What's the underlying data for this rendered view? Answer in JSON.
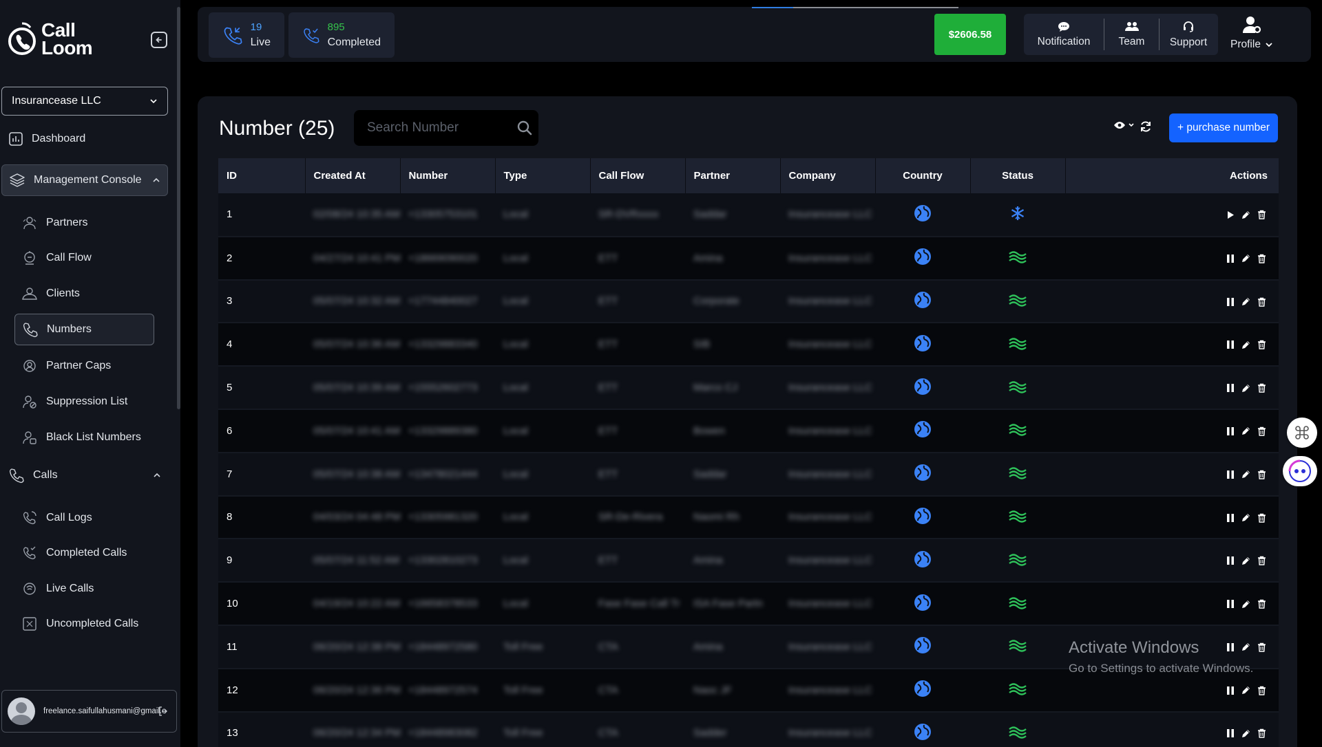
{
  "brand": {
    "name_line1": "Call",
    "name_line2": "Loom"
  },
  "company_selector": {
    "value": "Insurancease LLC"
  },
  "sidebar": {
    "dashboard": "Dashboard",
    "management_console": "Management Console",
    "management_items": [
      "Partners",
      "Call Flow",
      "Clients",
      "Numbers",
      "Partner Caps",
      "Suppression List",
      "Black List Numbers"
    ],
    "calls_group": "Calls",
    "calls_items": [
      "Call Logs",
      "Completed Calls",
      "Live Calls",
      "Uncompleted Calls"
    ],
    "user_email": "freelance.saifullahusmani@gmail.com"
  },
  "topbar": {
    "live": {
      "count": "19",
      "label": "Live"
    },
    "completed": {
      "count": "895",
      "label": "Completed"
    },
    "balance": "$2606.58",
    "notification": "Notification",
    "team": "Team",
    "support": "Support",
    "profile": "Profile"
  },
  "page": {
    "title": "Number (25)",
    "search_placeholder": "Search Number",
    "purchase_label": "+ purchase number"
  },
  "table": {
    "columns": [
      "ID",
      "Created At",
      "Number",
      "Type",
      "Call Flow",
      "Partner",
      "Company",
      "Country",
      "Status",
      "Actions"
    ],
    "rows": [
      {
        "id": "1",
        "created": "02/08/24 10:35 AM",
        "number": "+13305753101",
        "type": "Local",
        "flow": "SR-DVRxxxx",
        "partner": "Saddar",
        "company": "Insurancease LLC",
        "status": "paused"
      },
      {
        "id": "2",
        "created": "04/27/24 10:41 PM",
        "number": "+18669090020",
        "type": "Local",
        "flow": "ETT",
        "partner": "Amina",
        "company": "Insurancease LLC",
        "status": "active"
      },
      {
        "id": "3",
        "created": "05/07/24 10:32 AM",
        "number": "+17744840027",
        "type": "Local",
        "flow": "ETT",
        "partner": "Corporate",
        "company": "Insurancease LLC",
        "status": "active"
      },
      {
        "id": "4",
        "created": "05/07/24 10:36 AM",
        "number": "+13329883340",
        "type": "Local",
        "flow": "ETT",
        "partner": "SIB",
        "company": "Insurancease LLC",
        "status": "active"
      },
      {
        "id": "5",
        "created": "05/07/24 10:39 AM",
        "number": "+15552602773",
        "type": "Local",
        "flow": "ETT",
        "partner": "Marco CJ",
        "company": "Insurancease LLC",
        "status": "active"
      },
      {
        "id": "6",
        "created": "05/07/24 10:41 AM",
        "number": "+13329889380",
        "type": "Local",
        "flow": "ETT",
        "partner": "Bowen",
        "company": "Insurancease LLC",
        "status": "active"
      },
      {
        "id": "7",
        "created": "05/07/24 10:38 AM",
        "number": "+13478021444",
        "type": "Local",
        "flow": "ETT",
        "partner": "Saddar",
        "company": "Insurancease LLC",
        "status": "active"
      },
      {
        "id": "8",
        "created": "04/03/24 04:48 PM",
        "number": "+13305981320",
        "type": "Local",
        "flow": "SR-De-Rivera",
        "partner": "Naomi Rh",
        "company": "Insurancease LLC",
        "status": "active"
      },
      {
        "id": "9",
        "created": "05/07/24 11:52 AM",
        "number": "+13302810273",
        "type": "Local",
        "flow": "ETT",
        "partner": "Amina",
        "company": "Insurancease LLC",
        "status": "active"
      },
      {
        "id": "10",
        "created": "04/19/24 10:22 AM",
        "number": "+16658378533",
        "type": "Local",
        "flow": "Fase Fase Call Tr",
        "partner": "ISA Fase Partn",
        "company": "Insurancease LLC",
        "status": "active"
      },
      {
        "id": "11",
        "created": "06/20/24 12:38 PM",
        "number": "+18448972580",
        "type": "Toll Free",
        "flow": "CTA",
        "partner": "Amina",
        "company": "Insurancease LLC",
        "status": "active"
      },
      {
        "id": "12",
        "created": "06/20/24 12:36 PM",
        "number": "+18448972574",
        "type": "Toll Free",
        "flow": "CTA",
        "partner": "Naoc JF",
        "company": "Insurancease LLC",
        "status": "active"
      },
      {
        "id": "13",
        "created": "06/20/24 12:34 PM",
        "number": "+18448983082",
        "type": "Toll Free",
        "flow": "CTA",
        "partner": "Sadder",
        "company": "Insurancease LLC",
        "status": "active"
      }
    ]
  },
  "watermark": {
    "line1": "Activate Windows",
    "line2": "Go to Settings to activate Windows."
  },
  "colors": {
    "accent": "#1463ff",
    "balance": "#1fae39",
    "live_count": "#4da3ff",
    "completed_count": "#35c24b",
    "status_active": "#2ec25a",
    "status_paused": "#3b82f6"
  }
}
